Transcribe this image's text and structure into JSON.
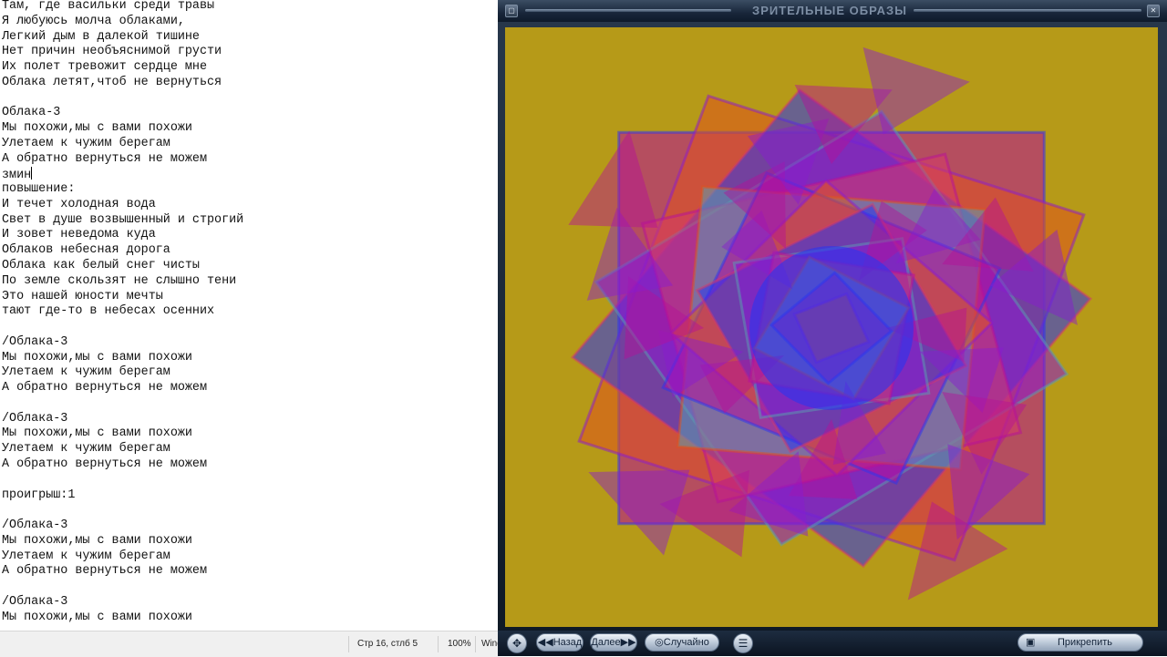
{
  "editor": {
    "lines": [
      "Там, где васильки среди травы",
      "Я любуюсь молча облаками,",
      "Легкий дым в далекой тишине",
      "Нет причин необъяснимой грусти",
      "Их полет тревожит сердце мне",
      "Облака летят,чтоб не вернуться",
      "",
      "Облака-3",
      "Мы похожи,мы с вами похожи",
      "Улетаем к чужим берегам",
      "А обратно вернуться не можем",
      "змин",
      "повышение:",
      "И течет холодная вода",
      "Свет в душе возвышенный и строгий",
      "И зовет неведома куда",
      "Облаков небесная дорога",
      "Облака как белый снег чисты",
      "По земле скользят не слышно тени",
      "Это нашей юности мечты",
      "тают где-то в небесах осенних",
      "",
      "/Облака-3",
      "Мы похожи,мы с вами похожи",
      "Улетаем к чужим берегам",
      "А обратно вернуться не можем",
      "",
      "/Облака-3",
      "Мы похожи,мы с вами похожи",
      "Улетаем к чужим берегам",
      "А обратно вернуться не можем",
      "",
      "проигрыш:1",
      "",
      "/Облака-3",
      "Мы похожи,мы с вами похожи",
      "Улетаем к чужим берегам",
      "А обратно вернуться не можем",
      "",
      "/Облака-3",
      "Мы похожи,мы с вами похожи"
    ],
    "caret_line_index": 11
  },
  "statusbar": {
    "position": "Стр 16, стлб 5",
    "zoom": "100%",
    "encoding_truncated": "Wind"
  },
  "visualizer": {
    "title": "ЗРИТЕЛЬНЫЕ ОБРАЗЫ",
    "back_label": "Назад",
    "next_label": "Далее",
    "random_label": "Случайно",
    "pin_label": "Прикрепить",
    "background_color": "#b69a18",
    "palette": [
      "#b5109a",
      "#e0541e",
      "#2a35f0",
      "#8a1ad0",
      "#d33a6a",
      "#5a9fb0"
    ]
  }
}
